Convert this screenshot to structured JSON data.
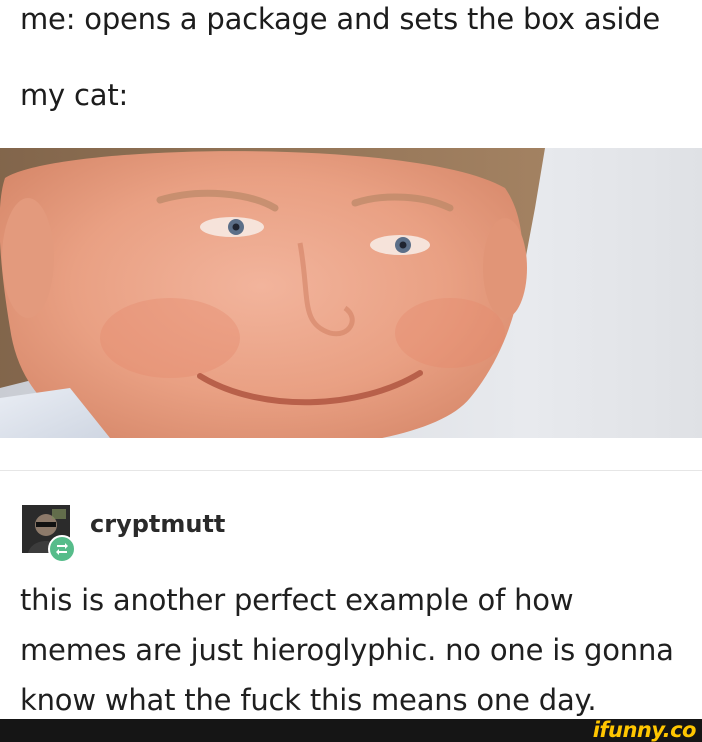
{
  "caption": {
    "line1": "me: opens a package and sets the box aside",
    "line2": "my cat:"
  },
  "post": {
    "username": "cryptmutt",
    "lines": [
      "this is another perfect example of how",
      "memes are just hieroglyphic. no one is gonna",
      "know what the fuck this means one day."
    ]
  },
  "watermark": "ifunny.co",
  "colors": {
    "reblog_badge": "#56bc8a",
    "watermark_text": "#ffc600",
    "watermark_bar": "#151515"
  },
  "icons": {
    "reblog": "reblog-icon"
  }
}
